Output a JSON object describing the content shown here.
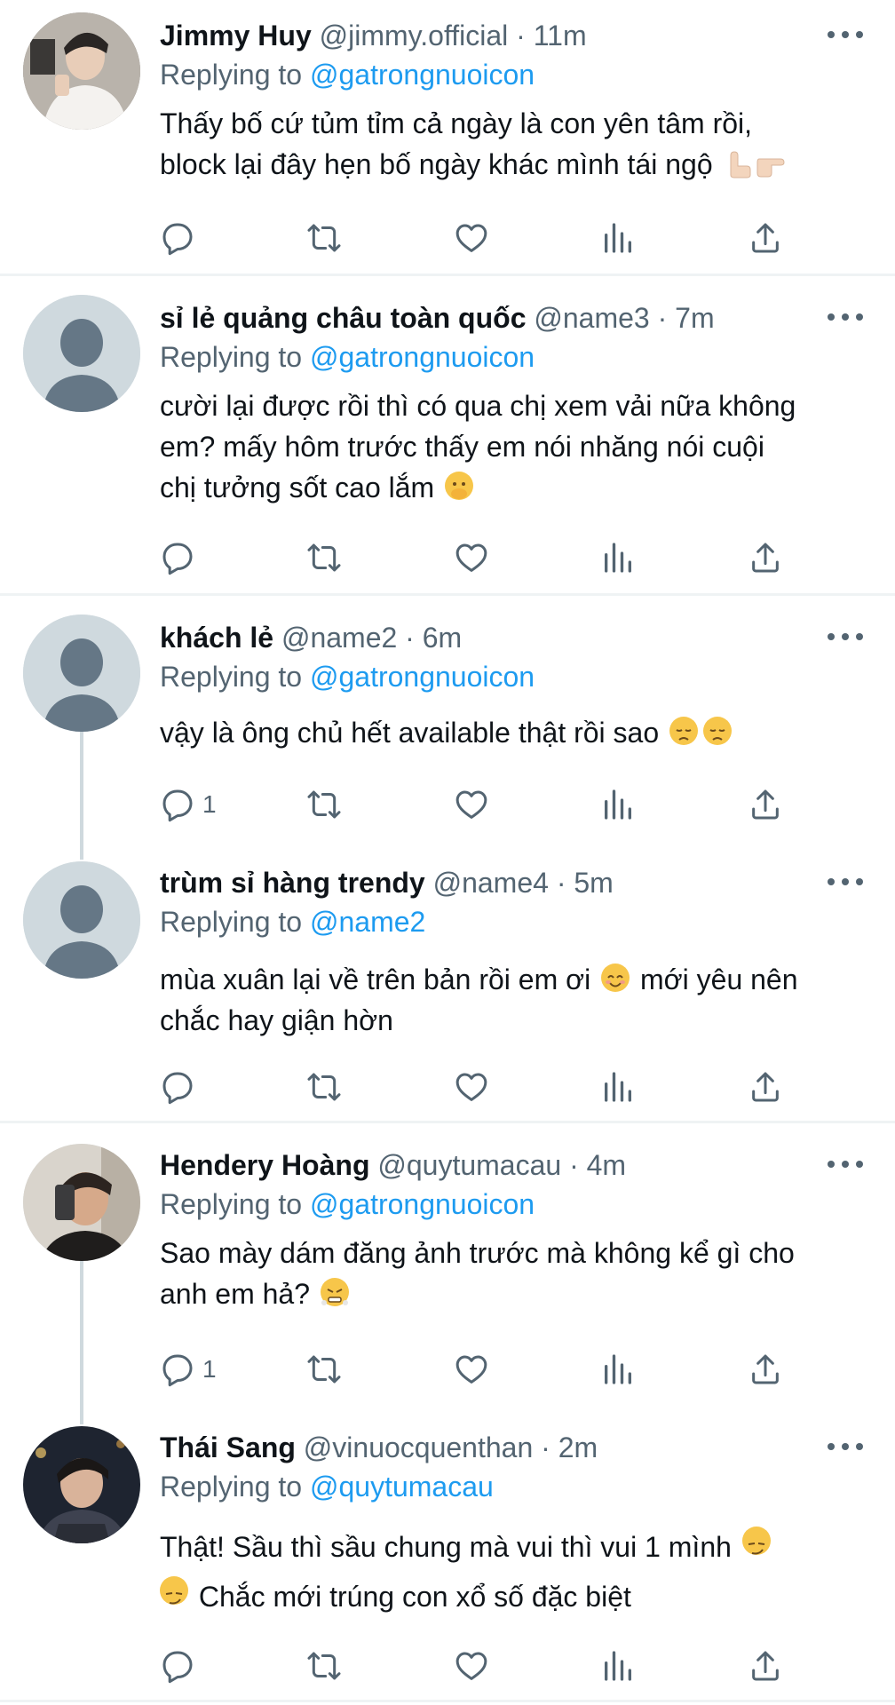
{
  "colors": {
    "text": "#0f1419",
    "secondary": "#536471",
    "link": "#1d9bf0",
    "divider": "#eff3f4",
    "default_avatar": "#cfd9de"
  },
  "reply_prefix": "Replying to",
  "tweets": [
    {
      "name": "Jimmy Huy",
      "handle": "@jimmy.official",
      "time": "11m",
      "replying_to": "@gatrongnuoicon",
      "text_line1": "Thấy bố cứ tủm tỉm cả ngày là con yên tâm rồi,",
      "text_line2": "block lại đây hẹn bố ngày khác mình tái ngộ",
      "emoji": "pointing-hands-emoji",
      "reply_count": ""
    },
    {
      "name": "sỉ lẻ quảng châu toàn quốc",
      "handle": "@name3",
      "time": "7m",
      "replying_to": "@gatrongnuoicon",
      "text_line1": "cười lại được rồi thì có qua chị xem vải nữa không",
      "text_line2": "em? mấy hôm trước thấy em nói nhăng nói cuội",
      "text_line3": "chị tưởng sốt cao lắm",
      "emoji": "hand-over-mouth-emoji",
      "reply_count": ""
    },
    {
      "name": "khách lẻ",
      "handle": "@name2",
      "time": "6m",
      "replying_to": "@gatrongnuoicon",
      "text_line1": "vậy là ông chủ hết available thật rồi sao",
      "emoji": "disappointed-face-emoji",
      "reply_count": "1"
    },
    {
      "name": "trùm sỉ hàng trendy",
      "handle": "@name4",
      "time": "5m",
      "replying_to": "@name2",
      "text_line1a": "mùa xuân lại về trên bản rồi em ơi",
      "text_line1b": "mới yêu nên",
      "text_line2": "chắc hay giận hờn",
      "emoji": "smiling-face-emoji",
      "reply_count": ""
    },
    {
      "name": "Hendery Hoàng",
      "handle": "@quytumacau",
      "time": "4m",
      "replying_to": "@gatrongnuoicon",
      "text_line1": "Sao mày dám đăng ảnh trước mà không kể gì cho",
      "text_line2": "anh em hả?",
      "emoji": "steam-from-nose-emoji",
      "reply_count": "1"
    },
    {
      "name": "Thái Sang",
      "handle": "@vinuocquenthan",
      "time": "2m",
      "replying_to": "@quytumacau",
      "text_line1": "Thật! Sầu thì sầu chung mà vui thì vui 1 mình",
      "text_line2": "Chắc mới trúng con xổ số đặc biệt",
      "emoji": "smirking-face-emoji",
      "reply_count": ""
    }
  ]
}
